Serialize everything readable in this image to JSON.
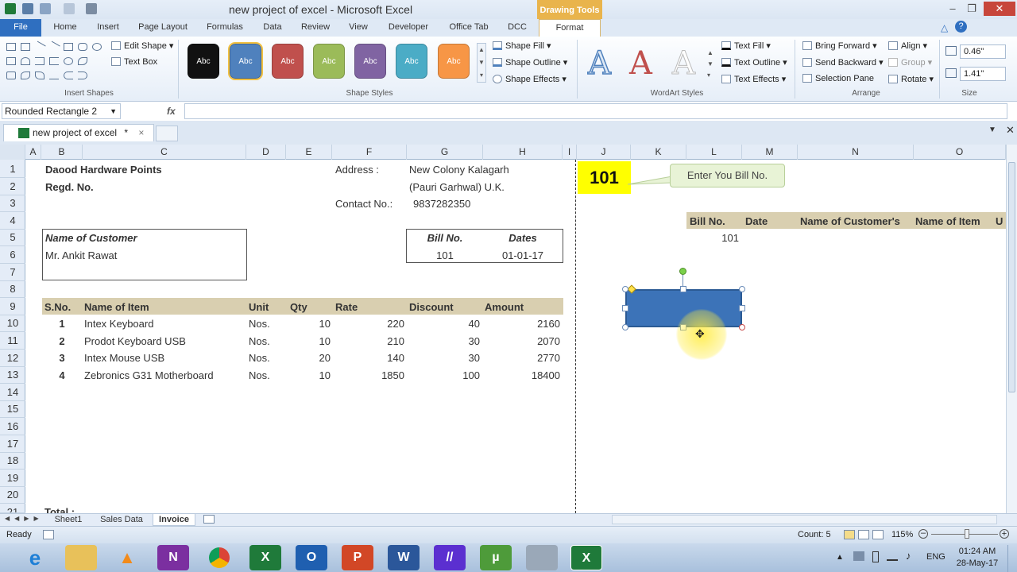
{
  "window": {
    "title": "new project of excel  - Microsoft Excel",
    "drawing_tools": "Drawing Tools",
    "min": "‒",
    "max": "❐",
    "close": "✕"
  },
  "tabs": [
    "File",
    "Home",
    "Insert",
    "Page Layout",
    "Formulas",
    "Data",
    "Review",
    "View",
    "Developer",
    "Office Tab",
    "DCC",
    "Format"
  ],
  "ribbon": {
    "insert_shapes": {
      "edit_shape": "Edit Shape",
      "text_box": "Text Box",
      "label": "Insert Shapes"
    },
    "shape_styles": {
      "swatch_text": "Abc",
      "fill": "Shape Fill",
      "outline": "Shape Outline",
      "effects": "Shape Effects",
      "label": "Shape Styles"
    },
    "wordart": {
      "letter": "A",
      "text_fill": "Text Fill",
      "text_outline": "Text Outline",
      "text_effects": "Text Effects",
      "label": "WordArt Styles"
    },
    "arrange": {
      "bring_forward": "Bring Forward",
      "send_backward": "Send Backward",
      "selection_pane": "Selection Pane",
      "align": "Align",
      "group": "Group",
      "rotate": "Rotate",
      "label": "Arrange"
    },
    "size": {
      "height": "0.46\"",
      "width": "1.41\"",
      "label": "Size"
    }
  },
  "colors": {
    "style_swatches": [
      "#111111",
      "#4f81bd",
      "#c0504d",
      "#9bbb59",
      "#8064a2",
      "#4bacc6",
      "#f79646"
    ],
    "accent": "#2f6fc0",
    "shape_fill": "#3c73b8",
    "header_band": "#d9cfb0",
    "highlight": "#ffff00"
  },
  "formula_bar": {
    "name_box": "Rounded Rectangle 2",
    "fx": "fx"
  },
  "doc_tab": {
    "name": "new project of excel",
    "modified": "*",
    "close": "×"
  },
  "columns": [
    "A",
    "B",
    "C",
    "D",
    "E",
    "F",
    "G",
    "H",
    "I",
    "J",
    "K",
    "L",
    "M",
    "N",
    "O"
  ],
  "rows": [
    "1",
    "2",
    "3",
    "4",
    "5",
    "6",
    "7",
    "8",
    "9",
    "10",
    "11",
    "12",
    "13",
    "14",
    "15",
    "16",
    "17",
    "18",
    "19",
    "20",
    "21"
  ],
  "invoice": {
    "company": "Daood Hardware Points",
    "regd": "Regd. No.",
    "address_label": "Address :",
    "address_1": "New Colony Kalagarh",
    "address_2": "(Pauri Garhwal) U.K.",
    "contact_label": "Contact No.:",
    "contact": "9837282350",
    "customer_label": "Name of Customer",
    "customer": "Mr. Ankit Rawat",
    "bill_label": "Bill No.",
    "dates_label": "Dates",
    "bill_no": "101",
    "date": "01-01-17",
    "headers": [
      "S.No.",
      "Name of Item",
      "Unit",
      "Qty",
      "Rate",
      "Discount",
      "Amount"
    ],
    "items": [
      [
        "1",
        "Intex Keyboard",
        "Nos.",
        "10",
        "220",
        "40",
        "2160"
      ],
      [
        "2",
        "Prodot Keyboard USB",
        "Nos.",
        "10",
        "210",
        "30",
        "2070"
      ],
      [
        "3",
        "Intex Mouse USB",
        "Nos.",
        "20",
        "140",
        "30",
        "2770"
      ],
      [
        "4",
        "Zebronics G31 Motherboard",
        "Nos.",
        "10",
        "1850",
        "100",
        "18400"
      ]
    ],
    "total_label": "Total :"
  },
  "side": {
    "bill_value": "101",
    "callout": "Enter You Bill No.",
    "headers": [
      "Bill No.",
      "Date",
      "Name of Customer's",
      "Name of Item",
      "U"
    ],
    "row_value": "101"
  },
  "sheets": [
    "Sheet1",
    "Sales Data",
    "Invoice"
  ],
  "status": {
    "ready": "Ready",
    "count": "Count: 5",
    "zoom": "115%"
  },
  "taskbar": {
    "lang": "ENG",
    "time": "01:24 AM",
    "date": "28-May-17"
  }
}
